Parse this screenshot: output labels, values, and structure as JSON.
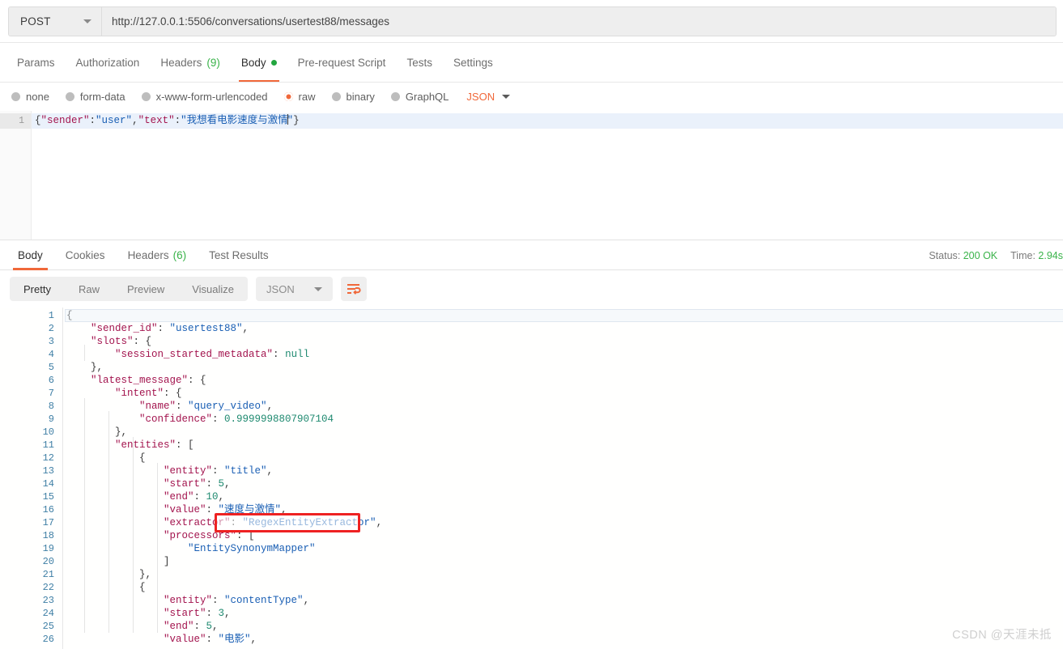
{
  "request": {
    "method": "POST",
    "url": "http://127.0.0.1:5506/conversations/usertest88/messages",
    "tabs": [
      {
        "label": "Params",
        "count": "",
        "active": false,
        "dot": false
      },
      {
        "label": "Authorization",
        "count": "",
        "active": false,
        "dot": false
      },
      {
        "label": "Headers",
        "count": "(9)",
        "active": false,
        "dot": false
      },
      {
        "label": "Body",
        "count": "",
        "active": true,
        "dot": true
      },
      {
        "label": "Pre-request Script",
        "count": "",
        "active": false,
        "dot": false
      },
      {
        "label": "Tests",
        "count": "",
        "active": false,
        "dot": false
      },
      {
        "label": "Settings",
        "count": "",
        "active": false,
        "dot": false
      }
    ],
    "body_modes": [
      {
        "label": "none",
        "selected": false
      },
      {
        "label": "form-data",
        "selected": false
      },
      {
        "label": "x-www-form-urlencoded",
        "selected": false
      },
      {
        "label": "raw",
        "selected": true
      },
      {
        "label": "binary",
        "selected": false
      },
      {
        "label": "GraphQL",
        "selected": false
      }
    ],
    "format_label": "JSON",
    "body_line_number": "1",
    "body_json": {
      "sender_key": "\"sender\"",
      "sender_val": "\"user\"",
      "text_key": "\"text\"",
      "text_val_prefix": "\"我想看电影速度与激情",
      "text_val_suffix": "\"",
      "open": "{",
      "close": "}",
      "colon": ":",
      "comma": ","
    }
  },
  "response": {
    "tabs": [
      {
        "label": "Body",
        "count": "",
        "active": true
      },
      {
        "label": "Cookies",
        "count": "",
        "active": false
      },
      {
        "label": "Headers",
        "count": "(6)",
        "active": false
      },
      {
        "label": "Test Results",
        "count": "",
        "active": false
      }
    ],
    "status_label": "Status:",
    "status_value": "200 OK",
    "time_label": "Time:",
    "time_value": "2.94s",
    "view_modes": [
      {
        "label": "Pretty",
        "active": true
      },
      {
        "label": "Raw",
        "active": false
      },
      {
        "label": "Preview",
        "active": false
      },
      {
        "label": "Visualize",
        "active": false
      }
    ],
    "format_label": "JSON",
    "wrap_icon": "word-wrap-icon",
    "lines": [
      {
        "n": "1",
        "indent": 0,
        "html": "<span class=\"p\">{</span>",
        "selected": true
      },
      {
        "n": "2",
        "indent": 1,
        "html": "<span class=\"k\">\"sender_id\"</span><span class=\"p\">: </span><span class=\"s\">\"usertest88\"</span><span class=\"p\">,</span>"
      },
      {
        "n": "3",
        "indent": 1,
        "html": "<span class=\"k\">\"slots\"</span><span class=\"p\">: {</span>"
      },
      {
        "n": "4",
        "indent": 2,
        "html": "<span class=\"k\">\"session_started_metadata\"</span><span class=\"p\">: </span><span class=\"nul\">null</span>"
      },
      {
        "n": "5",
        "indent": 1,
        "html": "<span class=\"p\">},</span>"
      },
      {
        "n": "6",
        "indent": 1,
        "html": "<span class=\"k\">\"latest_message\"</span><span class=\"p\">: {</span>"
      },
      {
        "n": "7",
        "indent": 2,
        "html": "<span class=\"k\">\"intent\"</span><span class=\"p\">: {</span>"
      },
      {
        "n": "8",
        "indent": 3,
        "html": "<span class=\"k\">\"name\"</span><span class=\"p\">: </span><span class=\"s\">\"query_video\"</span><span class=\"p\">,</span>"
      },
      {
        "n": "9",
        "indent": 3,
        "html": "<span class=\"k\">\"confidence\"</span><span class=\"p\">: </span><span class=\"n\">0.9999998807907104</span>"
      },
      {
        "n": "10",
        "indent": 2,
        "html": "<span class=\"p\">},</span>"
      },
      {
        "n": "11",
        "indent": 2,
        "html": "<span class=\"k\">\"entities\"</span><span class=\"p\">: [</span>"
      },
      {
        "n": "12",
        "indent": 3,
        "html": "<span class=\"p\">{</span>"
      },
      {
        "n": "13",
        "indent": 4,
        "html": "<span class=\"k\">\"entity\"</span><span class=\"p\">: </span><span class=\"s\">\"title\"</span><span class=\"p\">,</span>"
      },
      {
        "n": "14",
        "indent": 4,
        "html": "<span class=\"k\">\"start\"</span><span class=\"p\">: </span><span class=\"n\">5</span><span class=\"p\">,</span>"
      },
      {
        "n": "15",
        "indent": 4,
        "html": "<span class=\"k\">\"end\"</span><span class=\"p\">: </span><span class=\"n\">10</span><span class=\"p\">,</span>"
      },
      {
        "n": "16",
        "indent": 4,
        "html": "<span class=\"k\">\"value\"</span><span class=\"p\">: </span><span class=\"s\">\"速度与激情\"</span><span class=\"p\">,</span>"
      },
      {
        "n": "17",
        "indent": 4,
        "html": "<span class=\"k\">\"extractor\"</span><span class=\"p\">: </span><span class=\"s\">\"RegexEntityExtractor\"</span><span class=\"p\">,</span>"
      },
      {
        "n": "18",
        "indent": 4,
        "html": "<span class=\"k\">\"processors\"</span><span class=\"p\">: [</span>"
      },
      {
        "n": "19",
        "indent": 5,
        "html": "<span class=\"s\">\"EntitySynonymMapper\"</span>"
      },
      {
        "n": "20",
        "indent": 4,
        "html": "<span class=\"p\">]</span>"
      },
      {
        "n": "21",
        "indent": 3,
        "html": "<span class=\"p\">},</span>"
      },
      {
        "n": "22",
        "indent": 3,
        "html": "<span class=\"p\">{</span>"
      },
      {
        "n": "23",
        "indent": 4,
        "html": "<span class=\"k\">\"entity\"</span><span class=\"p\">: </span><span class=\"s\">\"contentType\"</span><span class=\"p\">,</span>"
      },
      {
        "n": "24",
        "indent": 4,
        "html": "<span class=\"k\">\"start\"</span><span class=\"p\">: </span><span class=\"n\">3</span><span class=\"p\">,</span>"
      },
      {
        "n": "25",
        "indent": 4,
        "html": "<span class=\"k\">\"end\"</span><span class=\"p\">: </span><span class=\"n\">5</span><span class=\"p\">,</span>"
      },
      {
        "n": "26",
        "indent": 4,
        "html": "<span class=\"k\">\"value\"</span><span class=\"p\">: </span><span class=\"s\">\"电影\"</span><span class=\"p\">,</span>"
      }
    ],
    "annotation": {
      "target_line": "17",
      "target_text": "\"RegexEntityExtractor\",",
      "color": "#ee2222"
    }
  },
  "watermark": "CSDN @天涯未抵",
  "colors": {
    "accent": "#f0683a",
    "success": "#3ab34a",
    "key": "#a3144e",
    "string": "#1a5fb4",
    "number": "#1f8a70",
    "annotation": "#ee2222"
  }
}
